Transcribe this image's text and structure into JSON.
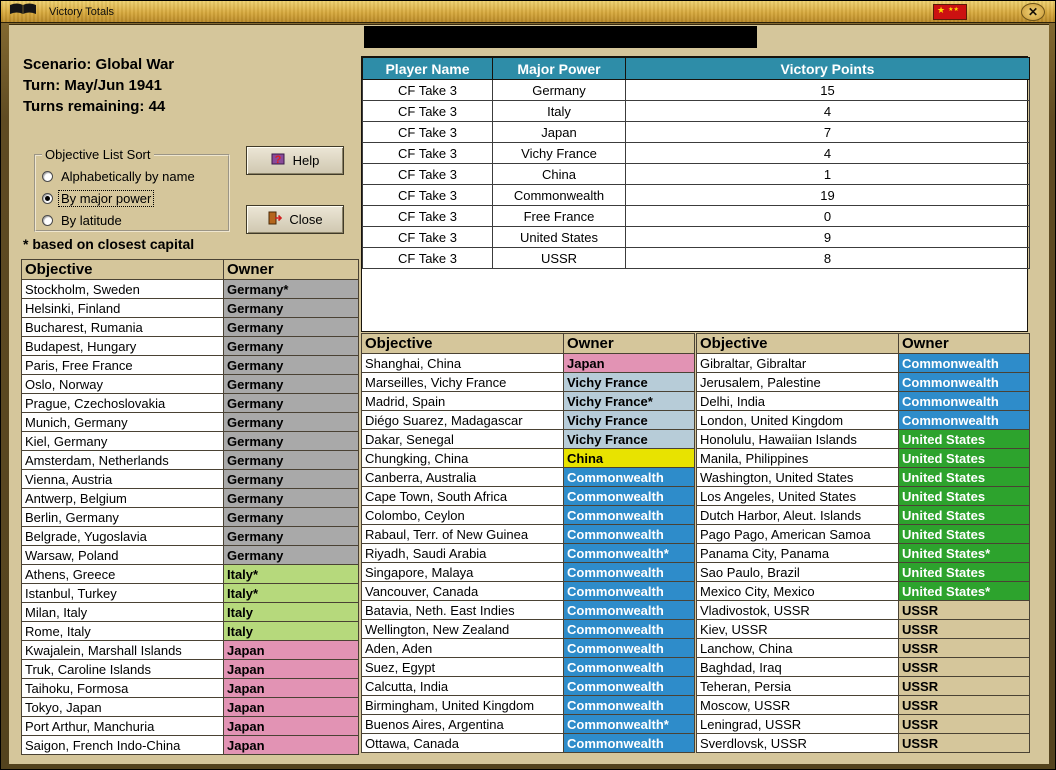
{
  "window": {
    "title": "Victory Totals",
    "close_glyph": "✕"
  },
  "colors": {
    "background": "#d5c69b",
    "victory_header_bg": "#2e8da8",
    "victory_header_fg": "#ffffff",
    "titlebar_gold": "#d8a93c",
    "flag_red": "#cc1111"
  },
  "info": {
    "scenario": "Scenario: Global War",
    "turn": "Turn: May/Jun 1941",
    "turns_remaining": "Turns remaining: 44"
  },
  "sort_box": {
    "legend": "Objective List Sort",
    "options": [
      {
        "label": "Alphabetically by name",
        "selected": false
      },
      {
        "label": "By major power",
        "selected": true
      },
      {
        "label": "By latitude",
        "selected": false
      }
    ]
  },
  "buttons": {
    "help": "Help",
    "close": "Close"
  },
  "footnote": "* based on closest capital",
  "owner_colors": {
    "germany": {
      "bg": "#a9a9a9",
      "fg": "#000000"
    },
    "italy": {
      "bg": "#b6d97c",
      "fg": "#000000"
    },
    "japan": {
      "bg": "#e293b4",
      "fg": "#000000"
    },
    "vichy": {
      "bg": "#b7ccd8",
      "fg": "#000000"
    },
    "china": {
      "bg": "#e8e300",
      "fg": "#000000"
    },
    "commonwealth": {
      "bg": "#2e8cca",
      "fg": "#ffffff"
    },
    "us": {
      "bg": "#2da32d",
      "fg": "#ffffff"
    },
    "ussr": {
      "bg": "#d5c69b",
      "fg": "#000000"
    }
  },
  "victory_table": {
    "headers": [
      "Player Name",
      "Major Power",
      "Victory Points"
    ],
    "rows": [
      {
        "player": "CF Take 3",
        "power": "Germany",
        "points": "15"
      },
      {
        "player": "CF Take 3",
        "power": "Italy",
        "points": "4"
      },
      {
        "player": "CF Take 3",
        "power": "Japan",
        "points": "7"
      },
      {
        "player": "CF Take 3",
        "power": "Vichy France",
        "points": "4"
      },
      {
        "player": "CF Take 3",
        "power": "China",
        "points": "1"
      },
      {
        "player": "CF Take 3",
        "power": "Commonwealth",
        "points": "19"
      },
      {
        "player": "CF Take 3",
        "power": "Free France",
        "points": "0"
      },
      {
        "player": "CF Take 3",
        "power": "United States",
        "points": "9"
      },
      {
        "player": "CF Take 3",
        "power": "USSR",
        "points": "8"
      }
    ]
  },
  "objective_tables": [
    {
      "id": "left",
      "headers": [
        "Objective",
        "Owner"
      ],
      "rows": [
        {
          "objective": "Stockholm, Sweden",
          "owner": "Germany*",
          "power": "germany"
        },
        {
          "objective": "Helsinki, Finland",
          "owner": "Germany",
          "power": "germany"
        },
        {
          "objective": "Bucharest, Rumania",
          "owner": "Germany",
          "power": "germany"
        },
        {
          "objective": "Budapest, Hungary",
          "owner": "Germany",
          "power": "germany"
        },
        {
          "objective": "Paris, Free France",
          "owner": "Germany",
          "power": "germany"
        },
        {
          "objective": "Oslo, Norway",
          "owner": "Germany",
          "power": "germany"
        },
        {
          "objective": "Prague, Czechoslovakia",
          "owner": "Germany",
          "power": "germany"
        },
        {
          "objective": "Munich, Germany",
          "owner": "Germany",
          "power": "germany"
        },
        {
          "objective": "Kiel, Germany",
          "owner": "Germany",
          "power": "germany"
        },
        {
          "objective": "Amsterdam, Netherlands",
          "owner": "Germany",
          "power": "germany"
        },
        {
          "objective": "Vienna, Austria",
          "owner": "Germany",
          "power": "germany"
        },
        {
          "objective": "Antwerp, Belgium",
          "owner": "Germany",
          "power": "germany"
        },
        {
          "objective": "Berlin, Germany",
          "owner": "Germany",
          "power": "germany"
        },
        {
          "objective": "Belgrade, Yugoslavia",
          "owner": "Germany",
          "power": "germany"
        },
        {
          "objective": "Warsaw, Poland",
          "owner": "Germany",
          "power": "germany"
        },
        {
          "objective": "Athens, Greece",
          "owner": "Italy*",
          "power": "italy"
        },
        {
          "objective": "Istanbul, Turkey",
          "owner": "Italy*",
          "power": "italy"
        },
        {
          "objective": "Milan, Italy",
          "owner": "Italy",
          "power": "italy"
        },
        {
          "objective": "Rome, Italy",
          "owner": "Italy",
          "power": "italy"
        },
        {
          "objective": "Kwajalein, Marshall Islands",
          "owner": "Japan",
          "power": "japan"
        },
        {
          "objective": "Truk, Caroline Islands",
          "owner": "Japan",
          "power": "japan"
        },
        {
          "objective": "Taihoku, Formosa",
          "owner": "Japan",
          "power": "japan"
        },
        {
          "objective": "Tokyo, Japan",
          "owner": "Japan",
          "power": "japan"
        },
        {
          "objective": "Port Arthur, Manchuria",
          "owner": "Japan",
          "power": "japan"
        },
        {
          "objective": "Saigon, French Indo-China",
          "owner": "Japan",
          "power": "japan"
        }
      ]
    },
    {
      "id": "middle",
      "headers": [
        "Objective",
        "Owner"
      ],
      "rows": [
        {
          "objective": "Shanghai, China",
          "owner": "Japan",
          "power": "japan"
        },
        {
          "objective": "Marseilles, Vichy France",
          "owner": "Vichy France",
          "power": "vichy"
        },
        {
          "objective": "Madrid, Spain",
          "owner": "Vichy France*",
          "power": "vichy"
        },
        {
          "objective": "Diégo Suarez, Madagascar",
          "owner": "Vichy France",
          "power": "vichy"
        },
        {
          "objective": "Dakar, Senegal",
          "owner": "Vichy France",
          "power": "vichy"
        },
        {
          "objective": "Chungking, China",
          "owner": "China",
          "power": "china"
        },
        {
          "objective": "Canberra, Australia",
          "owner": "Commonwealth",
          "power": "commonwealth"
        },
        {
          "objective": "Cape Town, South Africa",
          "owner": "Commonwealth",
          "power": "commonwealth"
        },
        {
          "objective": "Colombo, Ceylon",
          "owner": "Commonwealth",
          "power": "commonwealth"
        },
        {
          "objective": "Rabaul, Terr. of New Guinea",
          "owner": "Commonwealth",
          "power": "commonwealth"
        },
        {
          "objective": "Riyadh, Saudi Arabia",
          "owner": "Commonwealth*",
          "power": "commonwealth"
        },
        {
          "objective": "Singapore, Malaya",
          "owner": "Commonwealth",
          "power": "commonwealth"
        },
        {
          "objective": "Vancouver, Canada",
          "owner": "Commonwealth",
          "power": "commonwealth"
        },
        {
          "objective": "Batavia, Neth. East Indies",
          "owner": "Commonwealth",
          "power": "commonwealth"
        },
        {
          "objective": "Wellington, New Zealand",
          "owner": "Commonwealth",
          "power": "commonwealth"
        },
        {
          "objective": "Aden, Aden",
          "owner": "Commonwealth",
          "power": "commonwealth"
        },
        {
          "objective": "Suez, Egypt",
          "owner": "Commonwealth",
          "power": "commonwealth"
        },
        {
          "objective": "Calcutta, India",
          "owner": "Commonwealth",
          "power": "commonwealth"
        },
        {
          "objective": "Birmingham, United Kingdom",
          "owner": "Commonwealth",
          "power": "commonwealth"
        },
        {
          "objective": "Buenos Aires, Argentina",
          "owner": "Commonwealth*",
          "power": "commonwealth"
        },
        {
          "objective": "Ottawa, Canada",
          "owner": "Commonwealth",
          "power": "commonwealth"
        }
      ]
    },
    {
      "id": "right",
      "headers": [
        "Objective",
        "Owner"
      ],
      "rows": [
        {
          "objective": "Gibraltar, Gibraltar",
          "owner": "Commonwealth",
          "power": "commonwealth"
        },
        {
          "objective": "Jerusalem, Palestine",
          "owner": "Commonwealth",
          "power": "commonwealth"
        },
        {
          "objective": "Delhi, India",
          "owner": "Commonwealth",
          "power": "commonwealth"
        },
        {
          "objective": "London, United Kingdom",
          "owner": "Commonwealth",
          "power": "commonwealth"
        },
        {
          "objective": "Honolulu, Hawaiian Islands",
          "owner": "United States",
          "power": "us"
        },
        {
          "objective": "Manila, Philippines",
          "owner": "United States",
          "power": "us"
        },
        {
          "objective": "Washington, United States",
          "owner": "United States",
          "power": "us"
        },
        {
          "objective": "Los Angeles, United States",
          "owner": "United States",
          "power": "us"
        },
        {
          "objective": "Dutch Harbor, Aleut. Islands",
          "owner": "United States",
          "power": "us"
        },
        {
          "objective": "Pago Pago, American Samoa",
          "owner": "United States",
          "power": "us"
        },
        {
          "objective": "Panama City, Panama",
          "owner": "United States*",
          "power": "us"
        },
        {
          "objective": "Sao Paulo, Brazil",
          "owner": "United States",
          "power": "us"
        },
        {
          "objective": "Mexico City, Mexico",
          "owner": "United States*",
          "power": "us"
        },
        {
          "objective": "Vladivostok, USSR",
          "owner": "USSR",
          "power": "ussr"
        },
        {
          "objective": "Kiev, USSR",
          "owner": "USSR",
          "power": "ussr"
        },
        {
          "objective": "Lanchow, China",
          "owner": "USSR",
          "power": "ussr"
        },
        {
          "objective": "Baghdad, Iraq",
          "owner": "USSR",
          "power": "ussr"
        },
        {
          "objective": "Teheran, Persia",
          "owner": "USSR",
          "power": "ussr"
        },
        {
          "objective": "Moscow, USSR",
          "owner": "USSR",
          "power": "ussr"
        },
        {
          "objective": "Leningrad, USSR",
          "owner": "USSR",
          "power": "ussr"
        },
        {
          "objective": "Sverdlovsk, USSR",
          "owner": "USSR",
          "power": "ussr"
        }
      ]
    }
  ]
}
